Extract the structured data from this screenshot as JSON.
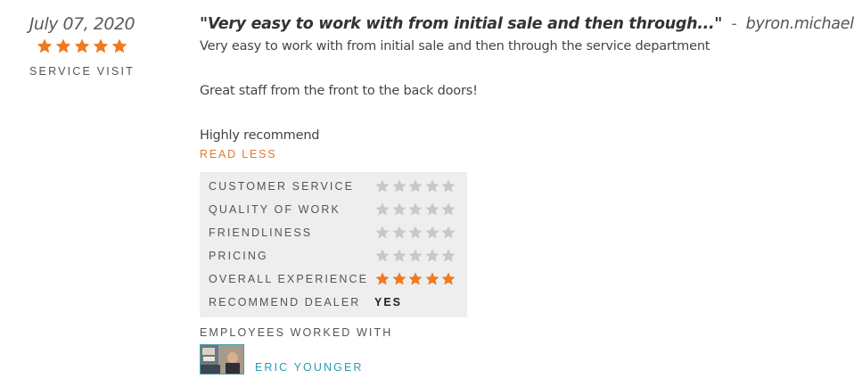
{
  "review": {
    "date": "July 07, 2020",
    "overall_stars": 5,
    "visit_type": "SERVICE VISIT",
    "title": "\"Very easy to work with from initial sale and then through...\"",
    "separator": "-",
    "author": "byron.michael",
    "body": [
      "Very easy to work with from initial sale and then through the service department",
      "Great staff from the front to the back doors!",
      "Highly recommend"
    ],
    "read_less_label": "READ LESS"
  },
  "ratings": [
    {
      "label": "CUSTOMER SERVICE",
      "stars": 0
    },
    {
      "label": "QUALITY OF WORK",
      "stars": 0
    },
    {
      "label": "FRIENDLINESS",
      "stars": 0
    },
    {
      "label": "PRICING",
      "stars": 0
    },
    {
      "label": "OVERALL EXPERIENCE",
      "stars": 5
    }
  ],
  "recommend": {
    "label": "RECOMMEND DEALER",
    "value": "YES"
  },
  "employees": {
    "heading": "EMPLOYEES WORKED WITH",
    "list": [
      {
        "name": "ERIC YOUNGER",
        "photo": "employee-photo-eric-younger"
      }
    ]
  },
  "colors": {
    "star_filled": "#f07a21",
    "star_empty": "#c8c8c8",
    "accent_orange": "#e07a2e",
    "link_teal": "#2a9bb0"
  }
}
